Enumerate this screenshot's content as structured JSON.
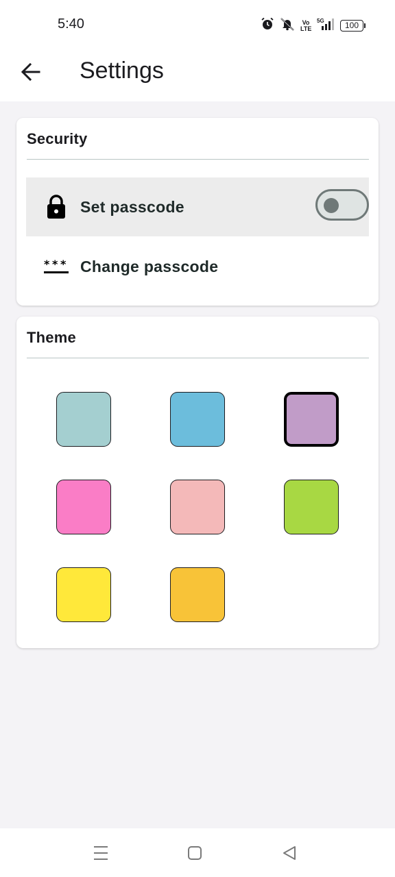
{
  "status_bar": {
    "time": "5:40",
    "volte_label": "Vo\nLTE",
    "network_label": "5G",
    "battery_label": "100",
    "icons": [
      "alarm-icon",
      "mute-icon",
      "volte-icon",
      "signal-icon",
      "battery-icon"
    ]
  },
  "app_bar": {
    "title": "Settings",
    "back_icon": "arrow-left-icon"
  },
  "security": {
    "title": "Security",
    "set_passcode": {
      "label": "Set passcode",
      "icon": "lock-icon",
      "toggle_on": false
    },
    "change_passcode": {
      "label": "Change passcode",
      "icon": "password-icon"
    }
  },
  "theme": {
    "title": "Theme",
    "swatches": [
      {
        "color": "#a4cfd0",
        "selected": false
      },
      {
        "color": "#6cbddc",
        "selected": false
      },
      {
        "color": "#c19cc8",
        "selected": true
      },
      {
        "color": "#fa7dc6",
        "selected": false
      },
      {
        "color": "#f4b9b9",
        "selected": false
      },
      {
        "color": "#a8d843",
        "selected": false
      },
      {
        "color": "#ffe83a",
        "selected": false
      },
      {
        "color": "#f8c338",
        "selected": false
      }
    ]
  },
  "nav_bar": {
    "icons": [
      "menu-icon",
      "home-square-icon",
      "back-triangle-icon"
    ]
  },
  "colors": {
    "background": "#f4f3f6",
    "surface": "#ffffff",
    "row_highlight": "#ececec",
    "toggle_outline": "#6f7978",
    "divider": "#b9c5c4"
  }
}
